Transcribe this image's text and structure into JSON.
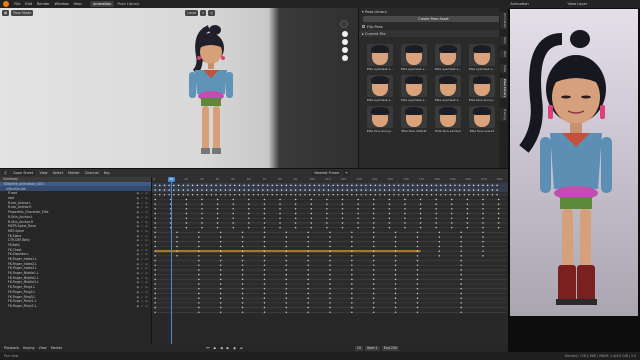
{
  "topbar": {
    "menus": [
      "File",
      "Edit",
      "Render",
      "Window",
      "Help"
    ],
    "workspaces": [
      "Animation",
      "Pose Library"
    ],
    "active_workspace": "Animation",
    "view_layer": "View Layer",
    "right_workspace": "Animation"
  },
  "viewport": {
    "mode": "Pose Mode",
    "orientation": "Local"
  },
  "pose_library": {
    "title": "Pose Library",
    "create_button": "Create Pose Asset",
    "flip_pose_label": "Flip Pose",
    "catalog": "Current File",
    "thumbnails": [
      "Ellie eyemask s...",
      "Ellie eyemask s...",
      "Ellie eyemask s...",
      "Ellie eyemask s...",
      "Ellie eyemask s...",
      "Ellie eyemask s...",
      "Ellie eyemask s...",
      "Ellie face annoy...",
      "Ellie face annoy...",
      "Ellie face default",
      "Ellie face excited",
      "Ellie face scared"
    ]
  },
  "side_tabs": [
    "Animation",
    "Item",
    "Tool",
    "View",
    "Pose Library",
    "Tracing"
  ],
  "dopesheet": {
    "editor": "Dope Sheet",
    "menus": [
      "View",
      "Select",
      "Marker",
      "Channel",
      "Key"
    ],
    "snap": "Nearest Frame",
    "current_frame": "10",
    "ruler_ticks": [
      "0",
      "10",
      "20",
      "30",
      "40",
      "50",
      "60",
      "70",
      "80",
      "90",
      "100",
      "110",
      "120",
      "130",
      "140",
      "150",
      "160",
      "170",
      "180",
      "190",
      "200",
      "210",
      "220"
    ],
    "channels": [
      "Summary",
      "Ellie|ellie_animation_v001",
      "ellie:ellie.rbk",
      "P-root",
      "root",
      "R-ear_Anchor.L",
      "R-ear_Anchor.R",
      "Properties_Character_Ellie",
      "R-Skin_Anchor.L",
      "R-Skin_Anchor.R",
      "MSTR-Spine_Torso",
      "MST-Spine",
      "FK-Spine",
      "CTR-DEF-Belly",
      "FK-Belly",
      "FK-Chest",
      "FK-Shoulder.L",
      "FK-Finger_Index1.L",
      "FK-Finger_Index2.L",
      "FK-Finger_Index3.L",
      "FK-Finger_Middle1.L",
      "FK-Finger_Middle2.L",
      "FK-Finger_Middle3.L",
      "FK-Finger_Ring1.L",
      "FK-Finger_Ring2.L",
      "FK-Finger_Ring3.L",
      "FK-Finger_Pinky1.L",
      "FK-Finger_Pinky2.L"
    ]
  },
  "playback": {
    "items": [
      "Playback",
      "Keying",
      "View",
      "Marker"
    ],
    "current": "10",
    "start_label": "Start",
    "start": "1",
    "end_label": "End",
    "end": "230"
  },
  "statusbar": {
    "left": "Pan View",
    "right": "Memory: 728.2 MiB | VRAM: 1.4/4.0 GiB | 3.0"
  },
  "colors": {
    "accent": "#4a8ad4",
    "orange_strip": "#d08a1a",
    "selected_channel": "#3d5a8a"
  }
}
